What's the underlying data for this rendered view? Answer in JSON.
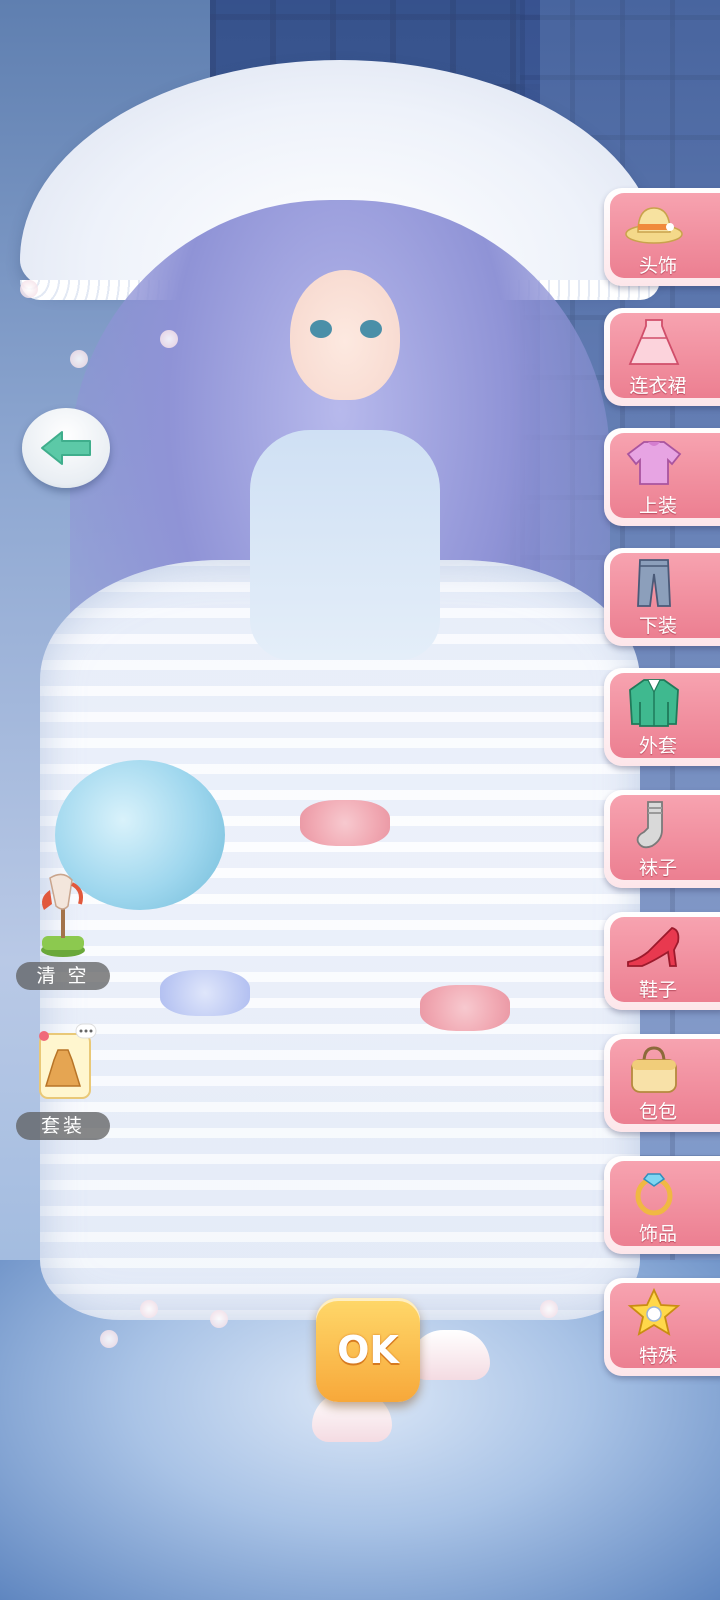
{
  "tools": {
    "clear_label": "清 空",
    "outfit_label": "套装"
  },
  "categories": [
    {
      "label": "头饰",
      "icon": "hat-icon"
    },
    {
      "label": "连衣裙",
      "icon": "dress-icon"
    },
    {
      "label": "上装",
      "icon": "top-icon"
    },
    {
      "label": "下装",
      "icon": "pants-icon"
    },
    {
      "label": "外套",
      "icon": "coat-icon"
    },
    {
      "label": "袜子",
      "icon": "sock-icon"
    },
    {
      "label": "鞋子",
      "icon": "high-heel-icon"
    },
    {
      "label": "包包",
      "icon": "handbag-icon"
    },
    {
      "label": "饰品",
      "icon": "ring-icon"
    },
    {
      "label": "特殊",
      "icon": "star-badge-icon"
    }
  ],
  "confirm": {
    "label": "OK"
  },
  "colors": {
    "category_pink": "#ec7f91",
    "back_arrow": "#5cc9a7",
    "ok_gold": "#f7a83a"
  }
}
